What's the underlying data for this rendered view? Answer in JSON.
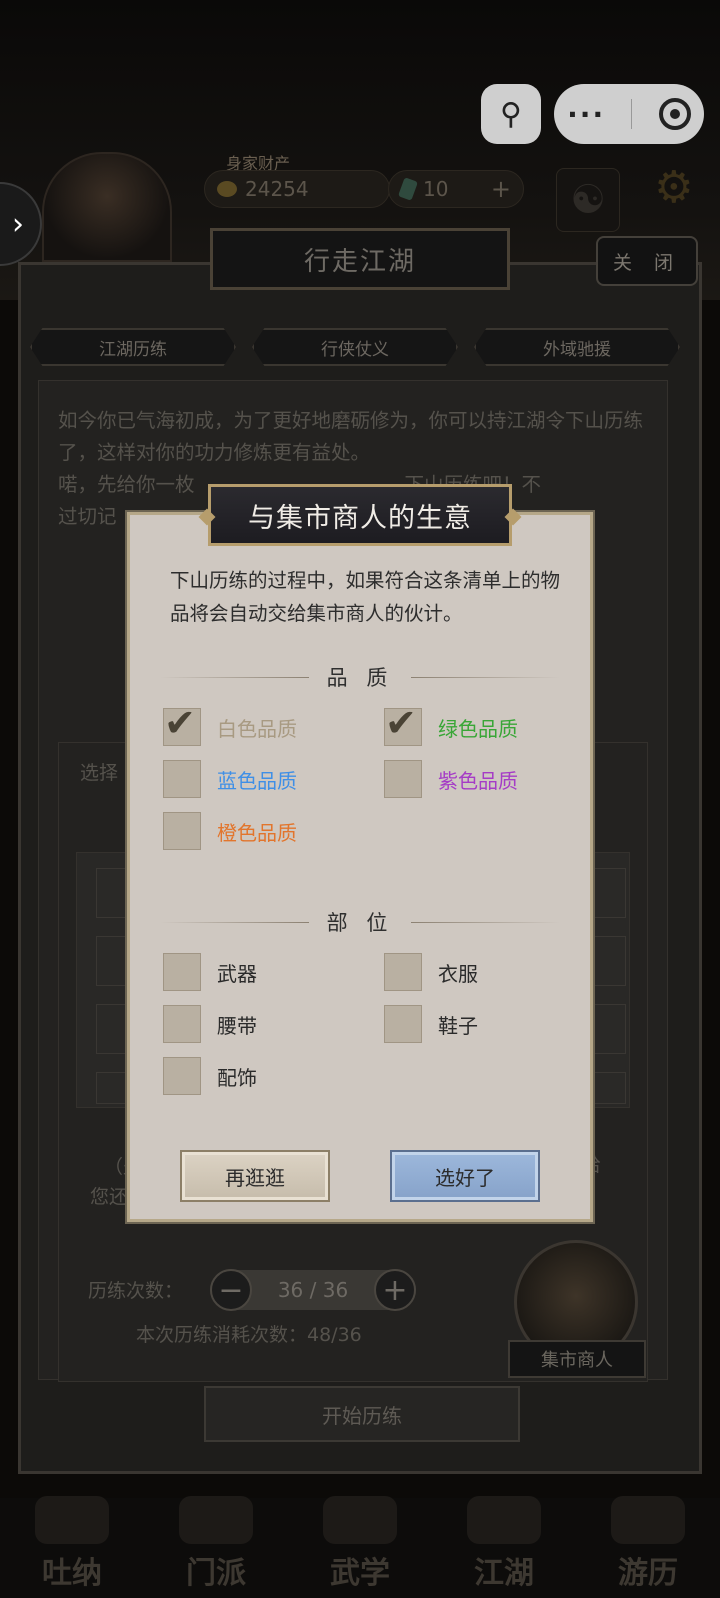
{
  "hud": {
    "wealth_label": "身家财产",
    "copper": "24254",
    "jade": "10",
    "plus": "+"
  },
  "mini_program": {
    "more": "···"
  },
  "panel": {
    "title": "行走江湖",
    "close": "关 闭",
    "tabs": [
      "江湖历练",
      "行侠仗义",
      "外域驰援"
    ],
    "intro_1": "如今你已气海初成，为了更好地磨砺修为，你可以持江湖令下山历练了，这样对你的功力修炼更有益处。",
    "intro_2": "喏，先给你一枚",
    "intro_2b": "下山历练吧！不",
    "intro_3": "过切记",
    "select_label": "选择",
    "note_prefix": "（少",
    "note_suffix": "给",
    "note_line2": "您还",
    "count_label": "历练次数：",
    "count_value": "36 / 36",
    "consume": "本次历练消耗次数：48/36",
    "start": "开始历练",
    "merchant": "集市商人"
  },
  "dialog": {
    "title": "与集市商人的生意",
    "description": "下山历练的过程中，如果符合这条清单上的物品将会自动交给集市商人的伙计。",
    "quality_header": "品 质",
    "part_header": "部 位",
    "qualities": [
      {
        "label": "白色品质",
        "checked": true,
        "color": "#a89a82"
      },
      {
        "label": "绿色品质",
        "checked": true,
        "color": "#38a636"
      },
      {
        "label": "蓝色品质",
        "checked": false,
        "color": "#3f8fe6"
      },
      {
        "label": "紫色品质",
        "checked": false,
        "color": "#a53cc6"
      },
      {
        "label": "橙色品质",
        "checked": false,
        "color": "#e2752c"
      }
    ],
    "parts": [
      {
        "label": "武器",
        "checked": false
      },
      {
        "label": "衣服",
        "checked": false
      },
      {
        "label": "腰带",
        "checked": false
      },
      {
        "label": "鞋子",
        "checked": false
      },
      {
        "label": "配饰",
        "checked": false
      }
    ],
    "btn_cancel": "再逛逛",
    "btn_confirm": "选好了"
  },
  "nav": [
    "吐纳",
    "门派",
    "武学",
    "江湖",
    "游历"
  ]
}
